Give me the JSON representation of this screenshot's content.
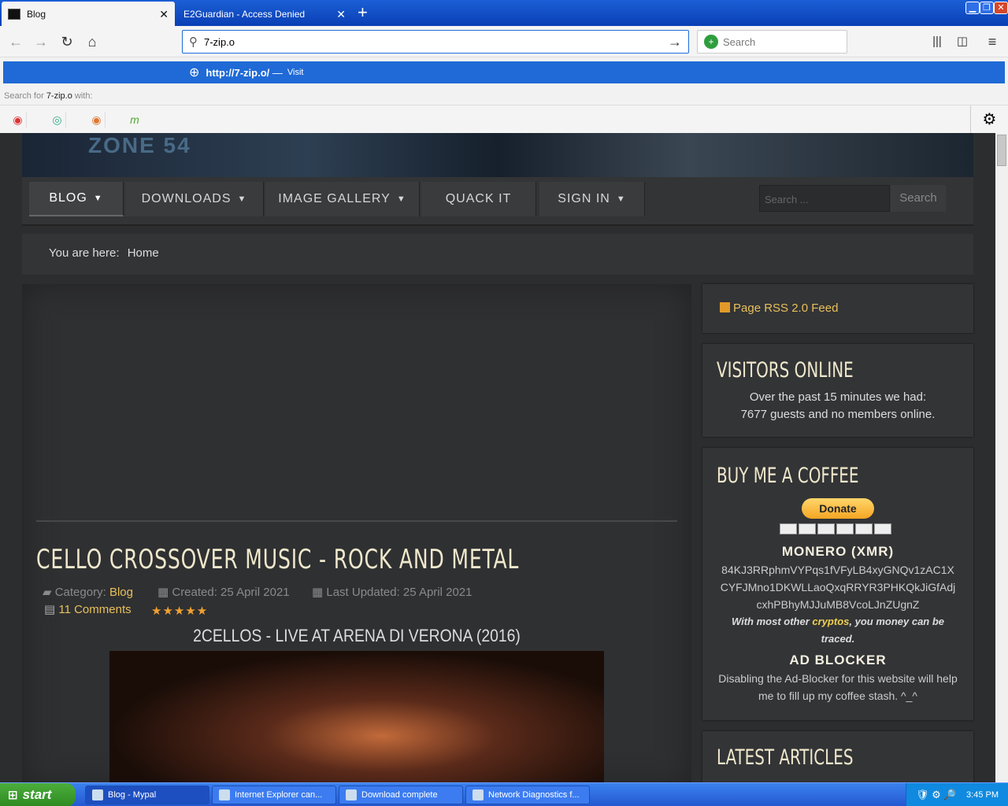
{
  "tabs": [
    {
      "label": "Blog"
    },
    {
      "label": "E2Guardian - Access Denied"
    }
  ],
  "url": {
    "value": "7-zip.o"
  },
  "search": {
    "placeholder": "Search"
  },
  "dropdown": {
    "suggestion_url": "http://7-zip.o/",
    "suggestion_sep": "—",
    "suggestion_action": "Visit",
    "search_for_prefix": "Search for",
    "search_for_query": "7-zip.o",
    "search_for_suffix": "with:"
  },
  "site": {
    "menu": [
      {
        "label": "BLOG"
      },
      {
        "label": "DOWNLOADS"
      },
      {
        "label": "IMAGE GALLERY"
      },
      {
        "label": "QUACK IT"
      },
      {
        "label": "SIGN IN"
      }
    ],
    "search_placeholder": "Search ...",
    "search_button": "Search",
    "breadcrumb_prefix": "You are here:",
    "breadcrumb_home": "Home"
  },
  "article": {
    "title": "CELLO CROSSOVER MUSIC - ROCK AND METAL",
    "category_label": "Category:",
    "category": "Blog",
    "created": "Created: 25 April 2021",
    "updated": "Last Updated: 25 April 2021",
    "comments": "11 Comments",
    "stars": "★★★★★",
    "subtitle": "2CELLOS - LIVE AT ARENA DI VERONA (2016)"
  },
  "sidebar": {
    "rss": "Page RSS 2.0 Feed",
    "visitors_title": "VISITORS ONLINE",
    "visitors_line1": "Over the past 15 minutes we had:",
    "visitors_line2": "7677 guests and no members online.",
    "coffee_title": "BUY ME A COFFEE",
    "donate": "Donate",
    "monero_title": "MONERO (XMR)",
    "monero_address": "84KJ3RRphmVYPqs1fVFyLB4xyGNQv1zAC1XCYFJMno1DKWLLaoQxqRRYR3PHKQkJiGfAdjcxhPBhyMJJuMB8VcoLJnZUgnZ",
    "crypto_pre": "With most other",
    "crypto_link": "cryptos",
    "crypto_post": ", you money can be traced.",
    "adblock_title": "AD BLOCKER",
    "adblock_text": "Disabling the Ad-Blocker for this website will help me to fill up my coffee stash. ^_^",
    "latest_title": "LATEST ARTICLES"
  },
  "taskbar": {
    "start": "start",
    "tasks": [
      {
        "label": "Blog - Mypal"
      },
      {
        "label": "Internet Explorer can..."
      },
      {
        "label": "Download complete"
      },
      {
        "label": "Network Diagnostics f..."
      }
    ],
    "clock": "3:45 PM"
  }
}
